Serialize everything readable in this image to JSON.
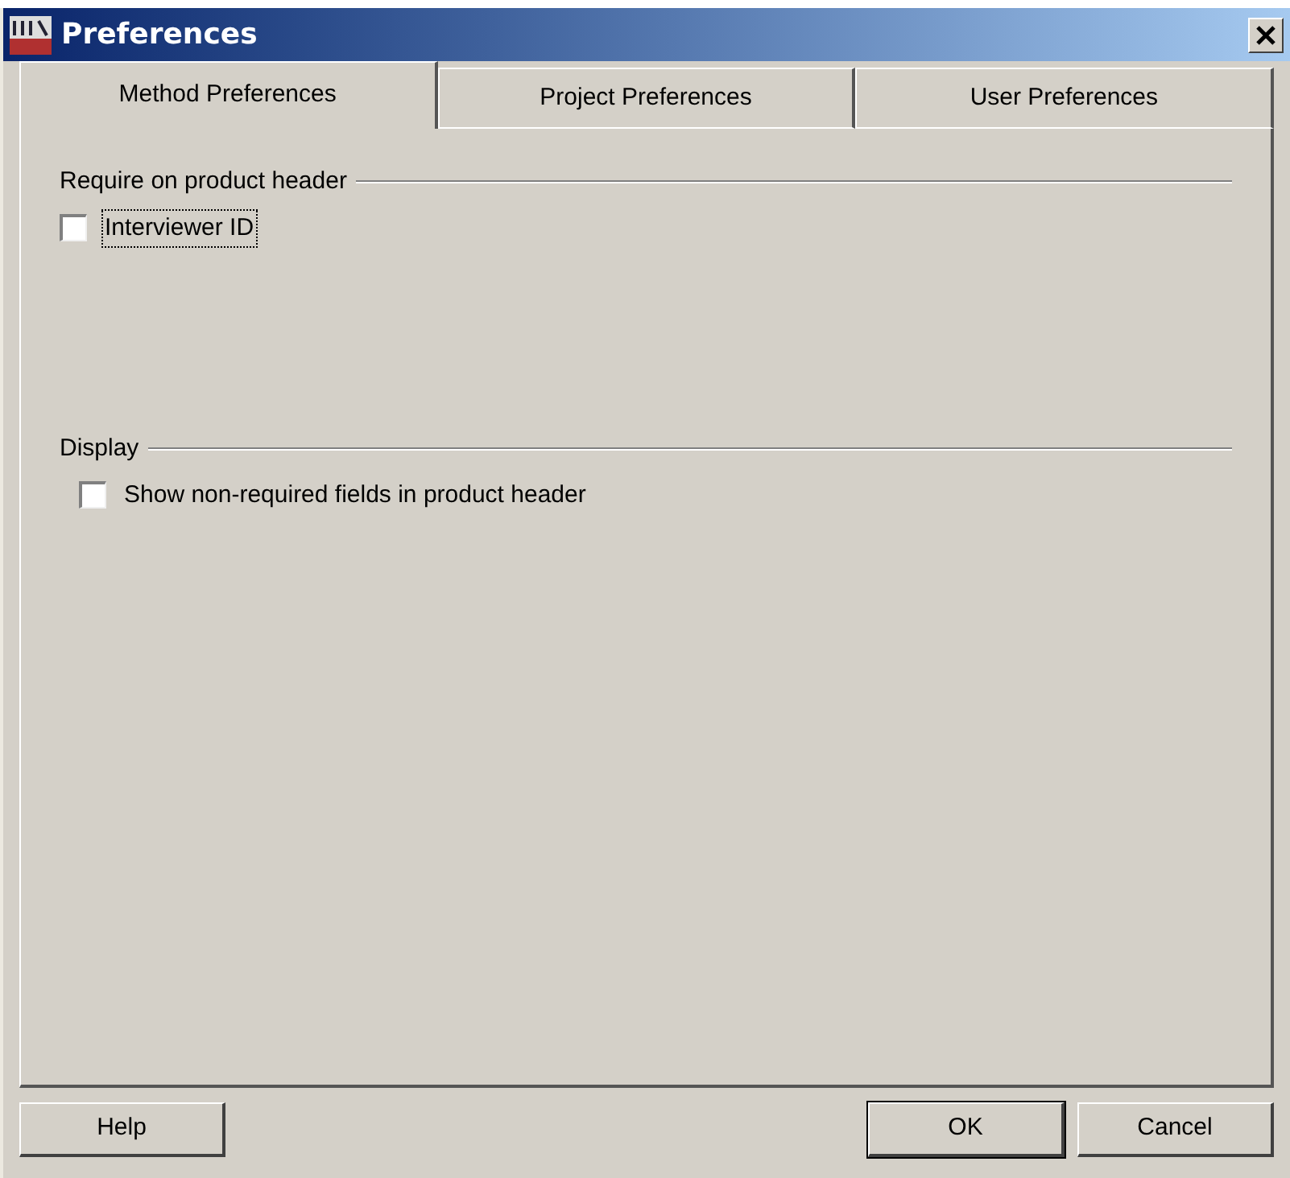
{
  "window": {
    "title": "Preferences"
  },
  "tabs": [
    {
      "label": "Method Preferences",
      "selected": true
    },
    {
      "label": "Project Preferences",
      "selected": false
    },
    {
      "label": "User Preferences",
      "selected": false
    }
  ],
  "groups": [
    {
      "title": "Require on product header",
      "options": [
        {
          "label": "Interviewer ID",
          "checked": false,
          "focused": true
        }
      ]
    },
    {
      "title": "Display",
      "options": [
        {
          "label": "Show non-required fields in product header",
          "checked": false,
          "focused": false
        }
      ]
    }
  ],
  "buttons": {
    "left": [
      "Help"
    ],
    "right": [
      {
        "label": "OK",
        "default": true
      },
      {
        "label": "Cancel",
        "default": false
      }
    ]
  }
}
